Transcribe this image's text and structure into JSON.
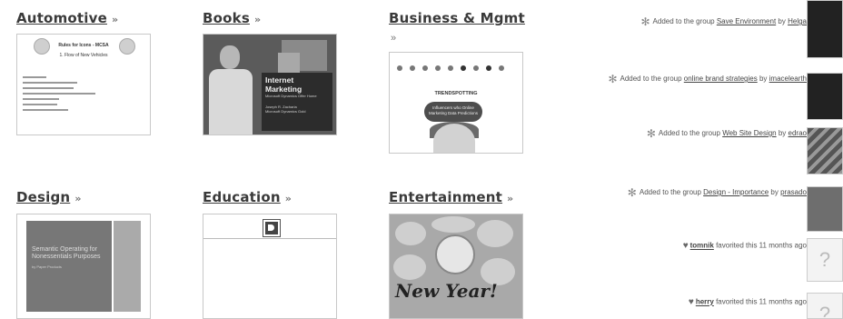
{
  "categories": [
    {
      "title": "Automotive",
      "raquo": "»"
    },
    {
      "title": "Books",
      "raquo": "»"
    },
    {
      "title": "Business & Mgmt",
      "raquo": "»"
    },
    {
      "title": "Design",
      "raquo": "»"
    },
    {
      "title": "Education",
      "raquo": "»"
    },
    {
      "title": "Entertainment",
      "raquo": "»"
    }
  ],
  "thumbnails": {
    "automotive": {
      "title": "Rules for Icons - MCSA",
      "subtitle": "1. Flow of New Vehicles"
    },
    "books": {
      "heading": "Internet Marketing",
      "line1": "Microsoft Dynamics Offer Home",
      "line2": "Joseph R. Zacharia",
      "line3": "Microsoft Dynamics Gold"
    },
    "business": {
      "heading": "TRENDSPOTTING",
      "bubble": "Influencers who Online Marketing Data Predictions"
    },
    "design": {
      "title": "Semantic Operating for Nonessentials Purposes",
      "byline": "by Paper Products"
    },
    "entertainment": {
      "text": "New Year!"
    }
  },
  "feed": [
    {
      "text": "Added to the group ",
      "link": "Save Environment",
      "by": " by ",
      "user": "Helga"
    },
    {
      "text": "Added to the group ",
      "link": "online brand strategies",
      "by": " by ",
      "user": "imacelearth"
    },
    {
      "text": "Added to the group ",
      "link": "Web Site Design",
      "by": " by ",
      "user": "edrao"
    },
    {
      "text": "Added to the group ",
      "link": "Design - Importance",
      "by": " by ",
      "user": "prasado"
    },
    {
      "user": "tomnik",
      "text": " favorited this 11 months ago"
    },
    {
      "user": "herry",
      "text": " favorited this 11 months ago"
    }
  ],
  "icons": {
    "star": "star-icon",
    "heart": "heart-icon",
    "placeholder": "?"
  }
}
